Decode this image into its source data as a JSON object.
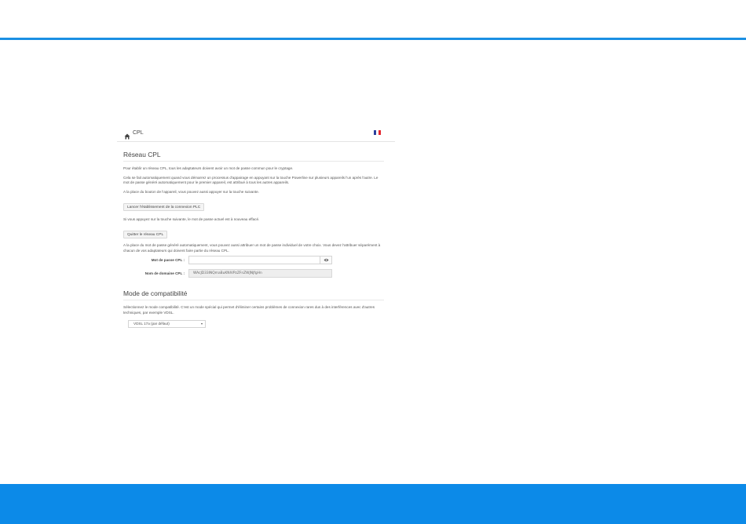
{
  "colors": {
    "accent": "#1b8fe3",
    "footer": "#0c8ae8"
  },
  "header": {
    "breadcrumb": "CPL",
    "home_icon": "home-icon",
    "flag": "french-flag-icon"
  },
  "plc_section": {
    "title": "Réseau CPL",
    "intro": "Pour établir un réseau CPL, tous les adaptateurs doivent avoir un mot de passe commun pour le cryptage.",
    "auto_text": "Cela se fait automatiquement quand vous démarrez un processus d'appairage en appuyant sur la touche Powerline sur plusieurs appareils l'un après l'autre. Le mot de passe généré automatiquement pour le premier appareil, est attribué à tous les autres appareils.",
    "button_hint": "A la place du bouton de l'appareil, vous pouvez aussi appuyer sur la touche suivante.",
    "start_button": "Lancer l'établissement de la connexion PLC",
    "quit_hint": "Si vous appuyez sur la touche suivante, le mot de passe actuel est à nouveau effacé.",
    "quit_button": "Quitter le réseau CPL",
    "custom_text": "A la place du mot de passe généré automatiquement, vous pouvez aussi attribuer un mot de passe individuel de votre choix. Vous devez l'attribuer séparément à chacun de vos adaptateurs qui doivent faire partie du réseau CPL.",
    "password_label": "Mot de passe CPL :",
    "password_value": "",
    "eye_icon": "eye-icon",
    "domain_label": "Nom de domaine CPL :",
    "domain_value": "WAcJD33lNQmaBuKNIVPzZFnZWJNJfgHn"
  },
  "compat_section": {
    "title": "Mode de compatibilité",
    "text": "Sélectionnez le mode compatibilité. C'est un mode spécial qui permet d'éliminer certains problèmes de connexion rares dus à des interférences avec d'autres techniques, par exemple VDSL.",
    "selected_option": "VDSL 17a (par défaut)"
  }
}
